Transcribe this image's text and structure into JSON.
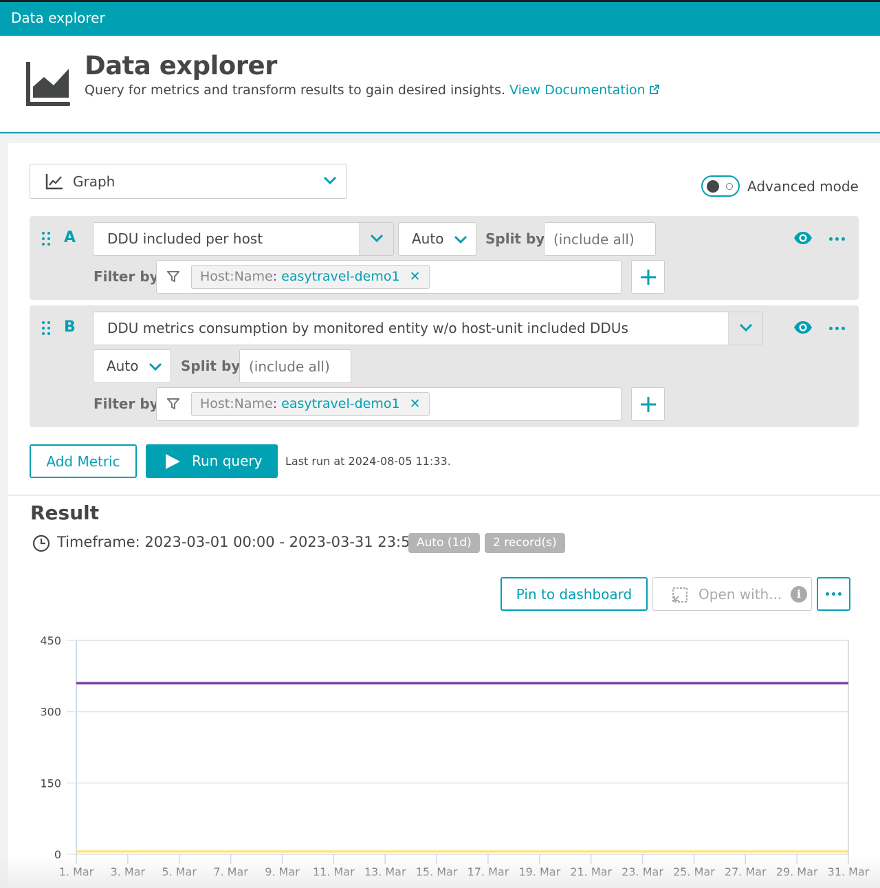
{
  "topbar": {
    "title": "Data explorer"
  },
  "header": {
    "title": "Data explorer",
    "subtitle": "Query for metrics and transform results to gain desired insights.",
    "doc_link": "View Documentation",
    "logo_icon": "area-chart-icon",
    "link_icon": "external-link-icon"
  },
  "visualization": {
    "selected": "Graph",
    "icon": "line-chart-icon"
  },
  "advanced_mode": {
    "label": "Advanced mode",
    "enabled": false
  },
  "metrics": [
    {
      "letter": "A",
      "metric": "DDU included per host",
      "aggregation": "Auto",
      "split_label": "Split by",
      "split_placeholder": "(include all)",
      "filter_label": "Filter by",
      "filter_key": "Host:Name",
      "filter_sep": ":",
      "filter_value": "easytravel-demo1",
      "remove_glyph": "✕"
    },
    {
      "letter": "B",
      "metric": "DDU metrics consumption by monitored entity w/o host-unit included DDUs",
      "aggregation": "Auto",
      "split_label": "Split by",
      "split_placeholder": "(include all)",
      "filter_label": "Filter by",
      "filter_key": "Host:Name",
      "filter_sep": ":",
      "filter_value": "easytravel-demo1",
      "remove_glyph": "✕"
    }
  ],
  "actions": {
    "add_metric": "Add Metric",
    "run_query": "Run query",
    "last_run": "Last run at 2024-08-05 11:33."
  },
  "result": {
    "title": "Result",
    "timeframe": "Timeframe: 2023-03-01 00:00 - 2023-03-31 23:59",
    "resolution_badge": "Auto (1d)",
    "records_badge": "2 record(s)",
    "pin_button": "Pin to dashboard",
    "open_with_button": "Open with...",
    "info_glyph": "i"
  },
  "colors": {
    "accent": "#00a1b2",
    "series_a": "#7c3aa8",
    "series_b": "#fbe68a"
  },
  "chart_data": {
    "type": "line",
    "title": "",
    "xlabel": "",
    "ylabel": "",
    "ylim": [
      0,
      450
    ],
    "yticks": [
      0,
      150,
      300,
      450
    ],
    "x_range": [
      "1. Mar",
      "31. Mar"
    ],
    "x_tick_labels": [
      "1. Mar",
      "3. Mar",
      "5. Mar",
      "7. Mar",
      "9. Mar",
      "11. Mar",
      "13. Mar",
      "15. Mar",
      "17. Mar",
      "19. Mar",
      "21. Mar",
      "23. Mar",
      "25. Mar",
      "27. Mar",
      "29. Mar",
      "31. Mar"
    ],
    "grid": true,
    "legend": "none",
    "series": [
      {
        "name": "DDU included per host",
        "color": "#7c3aa8",
        "values": [
          360,
          360,
          360,
          360,
          360,
          360,
          360,
          360,
          360,
          360,
          360,
          360,
          360,
          360,
          360,
          360,
          360,
          360,
          360,
          360,
          360,
          360,
          360,
          360,
          360,
          360,
          360,
          360,
          360,
          360,
          360
        ]
      },
      {
        "name": "DDU metrics consumption by monitored entity w/o host-unit included DDUs",
        "color": "#fbe68a",
        "values": [
          6,
          6,
          6,
          6,
          6,
          6,
          6,
          6,
          6,
          6,
          6,
          6,
          6,
          6,
          6,
          6,
          6,
          6,
          6,
          6,
          6,
          6,
          6,
          6,
          6,
          6,
          6,
          6,
          6,
          6,
          6
        ]
      }
    ]
  }
}
